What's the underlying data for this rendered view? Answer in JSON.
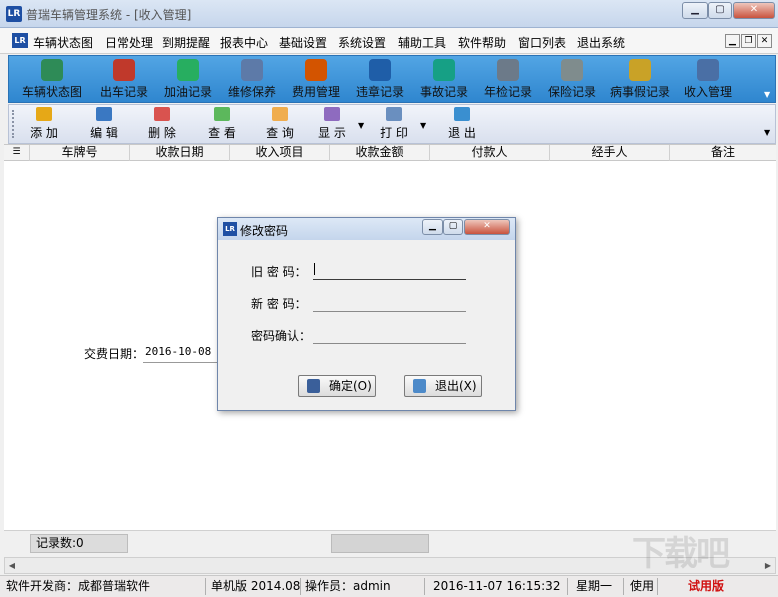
{
  "window": {
    "title": "普瑞车辆管理系统 - [收入管理]",
    "app_icon": "LR"
  },
  "menu": [
    "车辆状态图",
    "日常处理",
    "到期提醒",
    "报表中心",
    "基础设置",
    "系统设置",
    "辅助工具",
    "软件帮助",
    "窗口列表",
    "退出系统"
  ],
  "toolbar_main": [
    {
      "label": "车辆状态图",
      "icon": "coins-icon",
      "color": "#2e8b57"
    },
    {
      "label": "出车记录",
      "icon": "shapes-icon",
      "color": "#c0392b"
    },
    {
      "label": "加油记录",
      "icon": "network-icon",
      "color": "#27ae60"
    },
    {
      "label": "维修保养",
      "icon": "form-icon",
      "color": "#5d7aa8"
    },
    {
      "label": "费用管理",
      "icon": "book-icon",
      "color": "#d35400"
    },
    {
      "label": "违章记录",
      "icon": "info-icon",
      "color": "#1f5ea8"
    },
    {
      "label": "事故记录",
      "icon": "disc-icon",
      "color": "#16a085"
    },
    {
      "label": "年检记录",
      "icon": "chart-icon",
      "color": "#6c7a89"
    },
    {
      "label": "保险记录",
      "icon": "calendar-icon",
      "color": "#7f8c8d"
    },
    {
      "label": "病事假记录",
      "icon": "clipboard-icon",
      "color": "#c9a227"
    },
    {
      "label": "收入管理",
      "icon": "calculator-icon",
      "color": "#4a6fa5"
    }
  ],
  "toolbar_actions": [
    {
      "label": "添 加",
      "icon": "add-icon",
      "color": "#e6a817"
    },
    {
      "label": "编 辑",
      "icon": "edit-icon",
      "color": "#3a78c2"
    },
    {
      "label": "删 除",
      "icon": "delete-icon",
      "color": "#d9534f"
    },
    {
      "label": "查 看",
      "icon": "view-icon",
      "color": "#5cb85c"
    },
    {
      "label": "查 询",
      "icon": "query-icon",
      "color": "#f0ad4e"
    },
    {
      "label": "显 示",
      "icon": "display-icon",
      "color": "#8e6bbf"
    },
    {
      "label": "打 印",
      "icon": "print-icon",
      "color": "#6a8fbf"
    },
    {
      "label": "退 出",
      "icon": "exit-icon",
      "color": "#3a8fd0"
    }
  ],
  "columns": [
    "车牌号",
    "收款日期",
    "收入项目",
    "收款金额",
    "付款人",
    "经手人",
    "备注"
  ],
  "form": {
    "fee_date_label": "交费日期：",
    "fee_date_value": "2016-10-08"
  },
  "dialog": {
    "title": "修改密码",
    "old_label": "旧 密 码：",
    "new_label": "新 密 码：",
    "confirm_label": "密码确认：",
    "ok_label": "确定(O)",
    "cancel_label": "退出(X)"
  },
  "records_label": "记录数:0",
  "status": {
    "developer": "软件开发商：成都普瑞软件",
    "version": "单机版 2014.08",
    "operator": "操作员：admin",
    "datetime": "2016-11-07 16:15:32",
    "weekday": "星期一",
    "usage": "使用",
    "trial": "试用版",
    "trial_color": "#d01010"
  },
  "watermark": "下载吧"
}
